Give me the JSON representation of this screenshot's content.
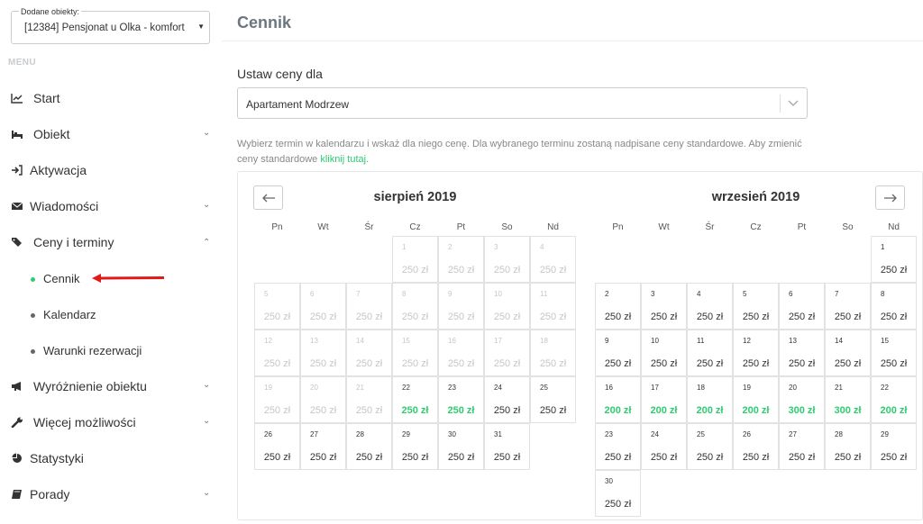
{
  "property": {
    "label": "Dodane obiekty:",
    "value": "[12384] Pensjonat u Olka - komfort"
  },
  "menu": {
    "heading": "MENU",
    "start": "Start",
    "obiekt": "Obiekt",
    "aktywacja": "Aktywacja",
    "wiadomosci": "Wiadomości",
    "ceny": "Ceny i terminy",
    "cennik": "Cennik",
    "kalendarz": "Kalendarz",
    "warunki": "Warunki rezerwacji",
    "wyroznienie": "Wyróżnienie obiektu",
    "wiecej": "Więcej możliwości",
    "statystyki": "Statystyki",
    "porady": "Porady"
  },
  "page": {
    "title": "Cennik",
    "set_label": "Ustaw ceny dla",
    "apartment": "Apartament Modrzew",
    "hint_text": "Wybierz termin w kalendarzu i wskaż dla niego cenę. Dla wybranego terminu zostaną nadpisane ceny standardowe. Aby zmienić ceny standardowe ",
    "hint_link": "kliknij tutaj",
    "hint_end": "."
  },
  "colors": {
    "accent": "#2ecc71",
    "past": "#c6c6c6",
    "title": "#6c7680"
  },
  "calendar": {
    "weekdays": [
      "Pn",
      "Wt",
      "Śr",
      "Cz",
      "Pt",
      "So",
      "Nd"
    ],
    "months": [
      {
        "title": "sierpień 2019",
        "offset": 3,
        "days": [
          {
            "d": "1",
            "p": "250 zł",
            "s": "past"
          },
          {
            "d": "2",
            "p": "250 zł",
            "s": "past"
          },
          {
            "d": "3",
            "p": "250 zł",
            "s": "past"
          },
          {
            "d": "4",
            "p": "250 zł",
            "s": "past"
          },
          {
            "d": "5",
            "p": "250 zł",
            "s": "past"
          },
          {
            "d": "6",
            "p": "250 zł",
            "s": "past"
          },
          {
            "d": "7",
            "p": "250 zł",
            "s": "past"
          },
          {
            "d": "8",
            "p": "250 zł",
            "s": "past"
          },
          {
            "d": "9",
            "p": "250 zł",
            "s": "past"
          },
          {
            "d": "10",
            "p": "250 zł",
            "s": "past"
          },
          {
            "d": "11",
            "p": "250 zł",
            "s": "past"
          },
          {
            "d": "12",
            "p": "250 zł",
            "s": "past"
          },
          {
            "d": "13",
            "p": "250 zł",
            "s": "past"
          },
          {
            "d": "14",
            "p": "250 zł",
            "s": "past"
          },
          {
            "d": "15",
            "p": "250 zł",
            "s": "past"
          },
          {
            "d": "16",
            "p": "250 zł",
            "s": "past"
          },
          {
            "d": "17",
            "p": "250 zł",
            "s": "past"
          },
          {
            "d": "18",
            "p": "250 zł",
            "s": "past"
          },
          {
            "d": "19",
            "p": "250 zł",
            "s": "past"
          },
          {
            "d": "20",
            "p": "250 zł",
            "s": "past"
          },
          {
            "d": "21",
            "p": "250 zł",
            "s": "past"
          },
          {
            "d": "22",
            "p": "250 zł",
            "s": "green"
          },
          {
            "d": "23",
            "p": "250 zł",
            "s": "green"
          },
          {
            "d": "24",
            "p": "250 zł",
            "s": "normal"
          },
          {
            "d": "25",
            "p": "250 zł",
            "s": "normal"
          },
          {
            "d": "26",
            "p": "250 zł",
            "s": "normal"
          },
          {
            "d": "27",
            "p": "250 zł",
            "s": "normal"
          },
          {
            "d": "28",
            "p": "250 zł",
            "s": "normal"
          },
          {
            "d": "29",
            "p": "250 zł",
            "s": "normal"
          },
          {
            "d": "30",
            "p": "250 zł",
            "s": "normal"
          },
          {
            "d": "31",
            "p": "250 zł",
            "s": "normal"
          }
        ]
      },
      {
        "title": "wrzesień 2019",
        "offset": 6,
        "days": [
          {
            "d": "1",
            "p": "250 zł",
            "s": "normal"
          },
          {
            "d": "2",
            "p": "250 zł",
            "s": "normal"
          },
          {
            "d": "3",
            "p": "250 zł",
            "s": "normal"
          },
          {
            "d": "4",
            "p": "250 zł",
            "s": "normal"
          },
          {
            "d": "5",
            "p": "250 zł",
            "s": "normal"
          },
          {
            "d": "6",
            "p": "250 zł",
            "s": "normal"
          },
          {
            "d": "7",
            "p": "250 zł",
            "s": "normal"
          },
          {
            "d": "8",
            "p": "250 zł",
            "s": "normal"
          },
          {
            "d": "9",
            "p": "250 zł",
            "s": "normal"
          },
          {
            "d": "10",
            "p": "250 zł",
            "s": "normal"
          },
          {
            "d": "11",
            "p": "250 zł",
            "s": "normal"
          },
          {
            "d": "12",
            "p": "250 zł",
            "s": "normal"
          },
          {
            "d": "13",
            "p": "250 zł",
            "s": "normal"
          },
          {
            "d": "14",
            "p": "250 zł",
            "s": "normal"
          },
          {
            "d": "15",
            "p": "250 zł",
            "s": "normal"
          },
          {
            "d": "16",
            "p": "200 zł",
            "s": "green"
          },
          {
            "d": "17",
            "p": "200 zł",
            "s": "green"
          },
          {
            "d": "18",
            "p": "200 zł",
            "s": "green"
          },
          {
            "d": "19",
            "p": "200 zł",
            "s": "green"
          },
          {
            "d": "20",
            "p": "300 zł",
            "s": "green"
          },
          {
            "d": "21",
            "p": "300 zł",
            "s": "green"
          },
          {
            "d": "22",
            "p": "200 zł",
            "s": "green"
          },
          {
            "d": "23",
            "p": "250 zł",
            "s": "normal"
          },
          {
            "d": "24",
            "p": "250 zł",
            "s": "normal"
          },
          {
            "d": "25",
            "p": "250 zł",
            "s": "normal"
          },
          {
            "d": "26",
            "p": "250 zł",
            "s": "normal"
          },
          {
            "d": "27",
            "p": "250 zł",
            "s": "normal"
          },
          {
            "d": "28",
            "p": "250 zł",
            "s": "normal"
          },
          {
            "d": "29",
            "p": "250 zł",
            "s": "normal"
          },
          {
            "d": "30",
            "p": "250 zł",
            "s": "normal"
          }
        ]
      }
    ]
  }
}
